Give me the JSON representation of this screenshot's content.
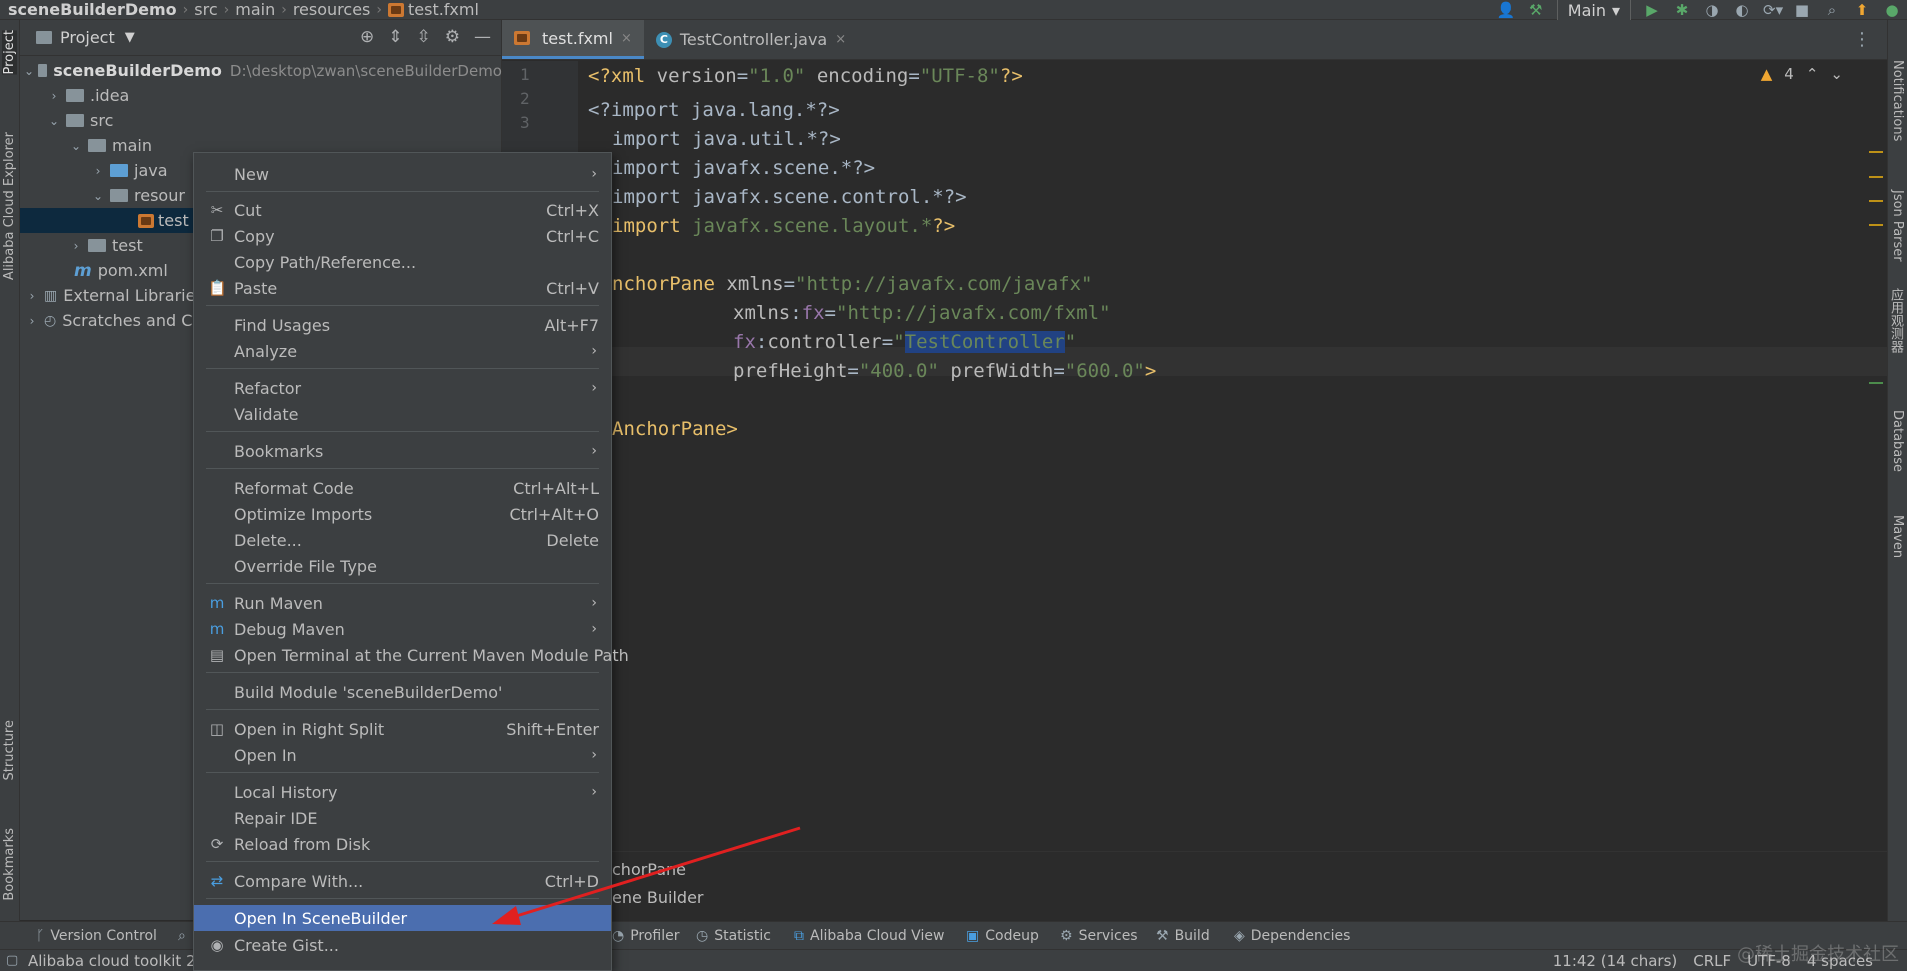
{
  "breadcrumb": {
    "project": "sceneBuilderDemo",
    "parts": [
      "src",
      "main",
      "resources"
    ],
    "file": "test.fxml"
  },
  "toolbar": {
    "run_config": "Main"
  },
  "left_strip": {
    "tabs": [
      "Project",
      "Alibaba Cloud Explorer",
      "Structure",
      "Bookmarks"
    ]
  },
  "right_strip": {
    "tabs": [
      "Notifications",
      "Json Parser",
      "应用观测器",
      "Database",
      "Maven"
    ]
  },
  "project_panel": {
    "title": "Project",
    "tree": [
      {
        "label": "sceneBuilderDemo",
        "path": "D:\\desktop\\zwan\\sceneBuilderDemo"
      },
      {
        "label": ".idea"
      },
      {
        "label": "src"
      },
      {
        "label": "main"
      },
      {
        "label": "java"
      },
      {
        "label": "resour"
      },
      {
        "label": "test"
      },
      {
        "label": "test"
      },
      {
        "label": "pom.xml"
      },
      {
        "label": "External Librarie"
      },
      {
        "label": "Scratches and C"
      }
    ]
  },
  "editor_tabs": [
    {
      "label": "test.fxml",
      "active": true
    },
    {
      "label": "TestController.java",
      "active": false
    }
  ],
  "editor": {
    "line_numbers": [
      "1",
      "2",
      "3"
    ],
    "warning_count": "4",
    "lines": {
      "l1": {
        "decl_open": "<?xml ",
        "a1": "version",
        "eq1": "=",
        "v1": "\"1.0\"",
        "sp": " ",
        "a2": "encoding",
        "eq2": "=",
        "v2": "\"UTF-8\"",
        "decl_close": "?>"
      },
      "l3": "<?import java.lang.*?>",
      "l4": "import java.util.*?>",
      "l5": "import javafx.scene.*?>",
      "l6": "import javafx.scene.control.*?>",
      "l7_kw": "import ",
      "l7_pkg": "javafx.scene.layout.*",
      "l7_end": "?>",
      "l9_tag": "nchorPane",
      "l9_attr": " xmlns",
      "l9_eq": "=",
      "l9_val": "\"http://javafx.com/javafx\"",
      "l10_ns": "xmlns",
      "l10_colon": ":",
      "l10_attr": "fx",
      "l10_eq": "=",
      "l10_val": "\"http://javafx.com/fxml\"",
      "l11_ns": "fx",
      "l11_colon": ":",
      "l11_attr": "controller",
      "l11_eq": "=",
      "l11_q1": "\"",
      "l11_sel": "TestController",
      "l11_q2": "\"",
      "l12_a1": "prefHeight",
      "l12_eq1": "=",
      "l12_v1": "\"400.0\"",
      "l12_a2": " prefWidth",
      "l12_eq2": "=",
      "l12_v2": "\"600.0\"",
      "l12_end": ">",
      "l14": "AnchorPane>"
    }
  },
  "editor_bottom": {
    "row1": "chorPane",
    "row2": "ene Builder"
  },
  "context_menu": {
    "items": [
      {
        "label": "New",
        "shortcut": "",
        "submenu": true
      },
      {
        "label": "Cut",
        "shortcut": "Ctrl+X"
      },
      {
        "label": "Copy",
        "shortcut": "Ctrl+C"
      },
      {
        "label": "Copy Path/Reference...",
        "shortcut": ""
      },
      {
        "label": "Paste",
        "shortcut": "Ctrl+V"
      },
      {
        "label": "Find Usages",
        "shortcut": "Alt+F7"
      },
      {
        "label": "Analyze",
        "shortcut": "",
        "submenu": true
      },
      {
        "label": "Refactor",
        "shortcut": "",
        "submenu": true
      },
      {
        "label": "Validate",
        "shortcut": ""
      },
      {
        "label": "Bookmarks",
        "shortcut": "",
        "submenu": true
      },
      {
        "label": "Reformat Code",
        "shortcut": "Ctrl+Alt+L"
      },
      {
        "label": "Optimize Imports",
        "shortcut": "Ctrl+Alt+O"
      },
      {
        "label": "Delete...",
        "shortcut": "Delete"
      },
      {
        "label": "Override File Type",
        "shortcut": ""
      },
      {
        "label": "Run Maven",
        "shortcut": "",
        "submenu": true
      },
      {
        "label": "Debug Maven",
        "shortcut": "",
        "submenu": true
      },
      {
        "label": "Open Terminal at the Current Maven Module Path",
        "shortcut": ""
      },
      {
        "label": "Build Module 'sceneBuilderDemo'",
        "shortcut": ""
      },
      {
        "label": "Open in Right Split",
        "shortcut": "Shift+Enter"
      },
      {
        "label": "Open In",
        "shortcut": "",
        "submenu": true
      },
      {
        "label": "Local History",
        "shortcut": "",
        "submenu": true
      },
      {
        "label": "Repair IDE",
        "shortcut": ""
      },
      {
        "label": "Reload from Disk",
        "shortcut": ""
      },
      {
        "label": "Compare With...",
        "shortcut": "Ctrl+D"
      },
      {
        "label": "Open In SceneBuilder",
        "shortcut": "",
        "highlighted": true
      },
      {
        "label": "Create Gist...",
        "shortcut": ""
      }
    ]
  },
  "bottom_tools": {
    "version_control": "Version Control",
    "profiler": "Profiler",
    "statistic": "Statistic",
    "alibaba_cloud_view": "Alibaba Cloud View",
    "codeup": "Codeup",
    "services": "Services",
    "build": "Build",
    "dependencies": "Dependencies"
  },
  "status": {
    "left": "Alibaba cloud toolkit 2",
    "position": "11:42 (14 chars)",
    "line_sep": "CRLF",
    "encoding": "UTF-8",
    "indent": "4 spaces"
  },
  "watermark": "@稀土掘金技术社区",
  "colors": {
    "accent": "#4b6eaf",
    "annotation_arrow": "#e02020"
  }
}
